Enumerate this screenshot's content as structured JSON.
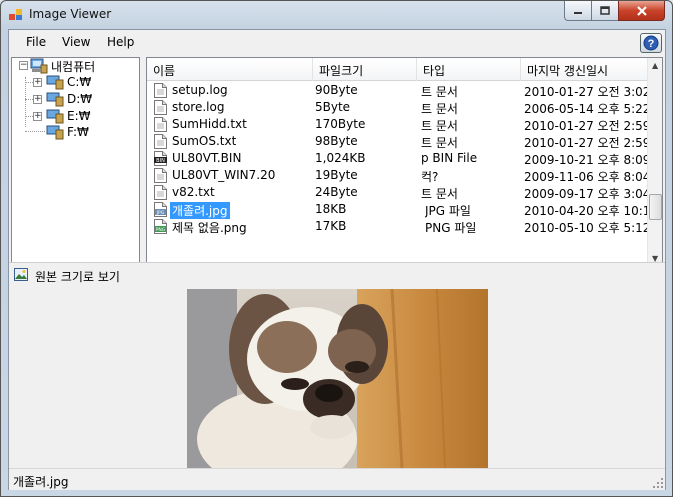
{
  "window": {
    "title": "Image Viewer",
    "minimize_label": "",
    "maximize_label": "",
    "close_label": ""
  },
  "menu": {
    "items": [
      "File",
      "View",
      "Help"
    ]
  },
  "tree": {
    "root": "내컴퓨터",
    "drives": [
      "C:₩",
      "D:₩",
      "E:₩",
      "F:₩"
    ]
  },
  "list": {
    "columns": [
      "이름",
      "파일크기",
      "타입",
      "마지막 갱신일시"
    ],
    "rows": [
      {
        "name": "setup.log",
        "size": "90Byte",
        "type": "트 문서",
        "modified": "2010-01-27 오전 3:02,",
        "icon": "text-file-icon"
      },
      {
        "name": "store.log",
        "size": "5Byte",
        "type": "트 문서",
        "modified": "2006-05-14 오후 5:22,",
        "icon": "text-file-icon"
      },
      {
        "name": "SumHidd.txt",
        "size": "170Byte",
        "type": "트 문서",
        "modified": "2010-01-27 오전 2:59,",
        "icon": "text-file-icon"
      },
      {
        "name": "SumOS.txt",
        "size": "98Byte",
        "type": "트 문서",
        "modified": "2010-01-27 오전 2:59,",
        "icon": "text-file-icon"
      },
      {
        "name": "UL80VT.BIN",
        "size": "1,024KB",
        "type": "p BIN File",
        "modified": "2009-10-21 오후 8:09,",
        "icon": "bin-file-icon"
      },
      {
        "name": "UL80VT_WIN7.20",
        "size": "19Byte",
        "type": "컥?",
        "modified": "2009-11-06 오후 8:04,",
        "icon": "text-file-icon"
      },
      {
        "name": "v82.txt",
        "size": "24Byte",
        "type": "트 문서",
        "modified": "2009-09-17 오후 3:04,",
        "icon": "text-file-icon"
      },
      {
        "name": "개졸려.jpg",
        "size": "18KB",
        "type": "JPG 파일",
        "modified": "2010-04-20 오후 10:1,",
        "icon": "jpg-file-icon",
        "selected": true
      },
      {
        "name": "제목 없음.png",
        "size": "17KB",
        "type": "PNG 파일",
        "modified": "2010-05-10 오후 5:12,",
        "icon": "png-file-icon"
      }
    ]
  },
  "viewer": {
    "toolbar_label": "원본 크기로 보기"
  },
  "status": {
    "text": "개졸려.jpg"
  },
  "colors": {
    "selection": "#3399ff",
    "close_button": "#c9432a"
  }
}
